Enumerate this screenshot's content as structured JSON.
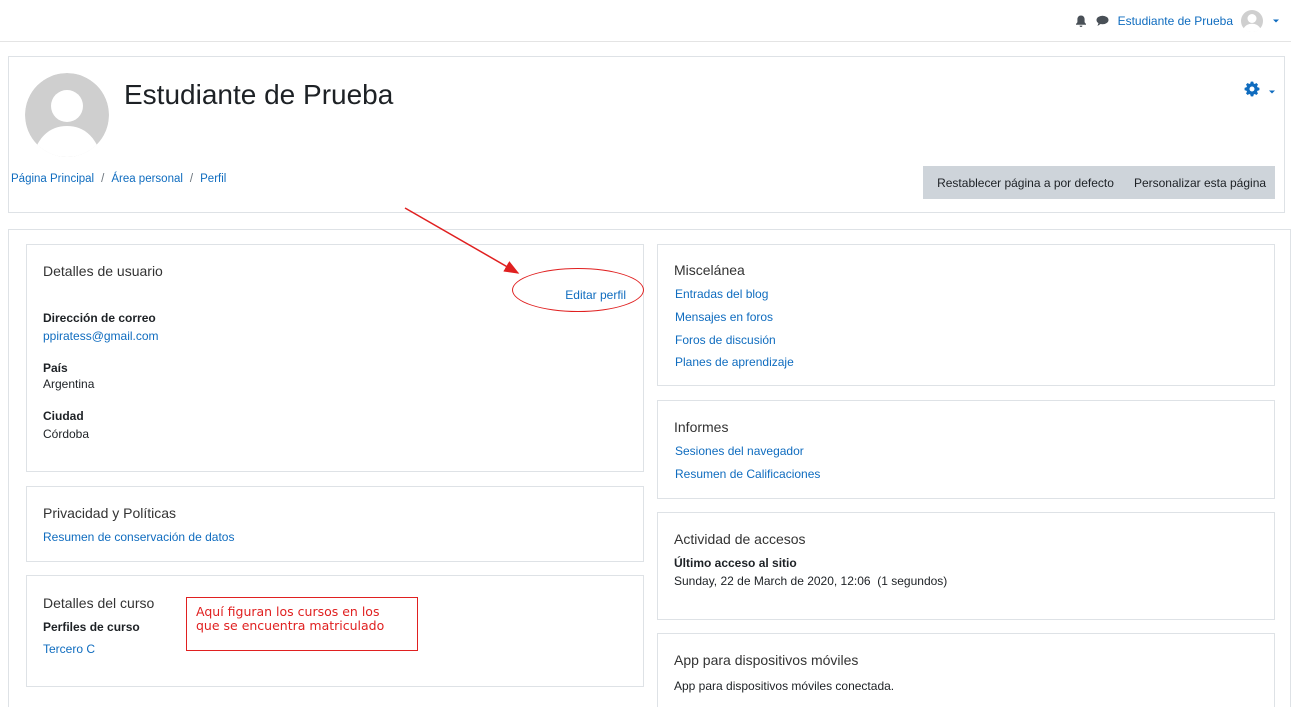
{
  "navbar": {
    "user_name": "Estudiante de Prueba",
    "icons": [
      "bell-icon",
      "chat-icon",
      "avatar",
      "caret-down-icon"
    ]
  },
  "header": {
    "title": "Estudiante de Prueba",
    "breadcrumb": [
      "Página Principal",
      "Área personal",
      "Perfil"
    ],
    "reset_button": "Restablecer página a por defecto",
    "customize_button": "Personalizar esta página",
    "settings_icon": "gear-icon"
  },
  "user_details": {
    "title": "Detalles de usuario",
    "edit_link": "Editar perfil",
    "email_label": "Dirección de correo",
    "email_value": "ppiratess@gmail.com",
    "country_label": "País",
    "country_value": "Argentina",
    "city_label": "Ciudad",
    "city_value": "Córdoba"
  },
  "privacy": {
    "title": "Privacidad y Políticas",
    "link": "Resumen de conservación de datos"
  },
  "course_details": {
    "title": "Detalles del curso",
    "profiles_label": "Perfiles de curso",
    "course_link": "Tercero C"
  },
  "misc": {
    "title": "Miscelánea",
    "links": [
      "Entradas del blog",
      "Mensajes en foros",
      "Foros de discusión",
      "Planes de aprendizaje"
    ]
  },
  "reports": {
    "title": "Informes",
    "links": [
      "Sesiones del navegador",
      "Resumen de Calificaciones"
    ]
  },
  "access": {
    "title": "Actividad de accesos",
    "last_access_label": "Último acceso al sitio",
    "last_access_value": "Sunday, 22 de March de 2020, 12:06  (1 segundos)"
  },
  "mobile": {
    "title": "App para dispositivos móviles",
    "status": "App para dispositivos móviles conectada."
  },
  "annotation": {
    "line1": "Aquí figuran los cursos en los",
    "line2": "que se encuentra matriculado",
    "color": "#e02020"
  },
  "colors": {
    "link": "#0f6cbf",
    "button_bg": "#ced4da",
    "border": "#dee2e6"
  }
}
